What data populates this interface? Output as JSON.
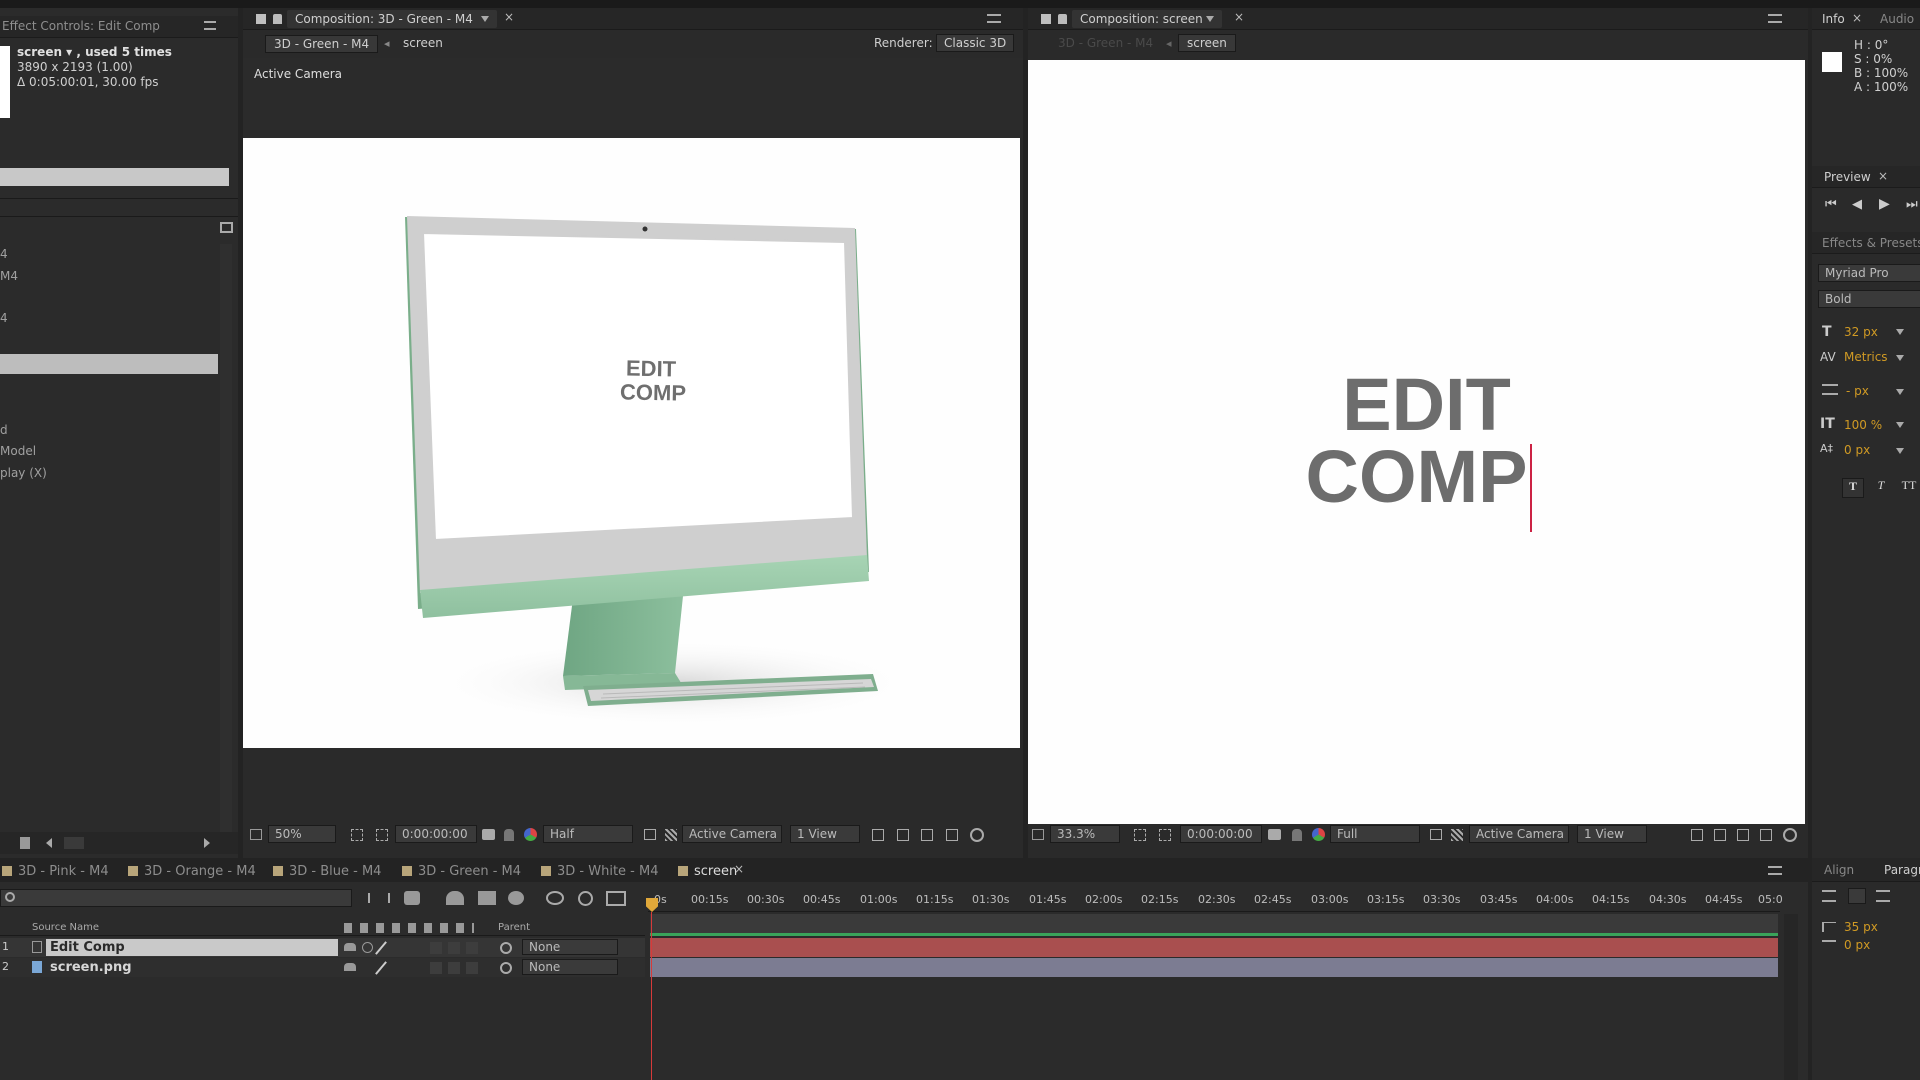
{
  "effect_controls": {
    "title": "Effect Controls: Edit Comp",
    "layer_name": "screen ▾ , used 5 times",
    "dims": "3890 x 2193 (1.00)",
    "duration": "Δ 0:05:00:01, 30.00 fps",
    "items": [
      "4",
      "M4",
      "4",
      "d",
      " Model",
      "play (X)"
    ]
  },
  "comp_left": {
    "tab": "Composition: 3D - Green - M4",
    "crumb1": "3D - Green - M4",
    "crumb2": "screen",
    "renderer_label": "Renderer:",
    "renderer_value": "Classic 3D",
    "camera_label": "Active Camera",
    "screen_text_1": "EDIT",
    "screen_text_2": "COMP",
    "footer": {
      "zoom": "50%",
      "time": "0:00:00:00",
      "quality": "Half",
      "camera": "Active Camera",
      "views": "1 View"
    }
  },
  "comp_right": {
    "tab": "Composition: screen",
    "crumb1": "3D - Green - M4",
    "crumb2": "screen",
    "text_1": "EDIT",
    "text_2": "COMP",
    "footer": {
      "zoom": "33.3%",
      "time": "0:00:00:00",
      "quality": "Full",
      "camera": "Active Camera",
      "views": "1 View"
    }
  },
  "info": {
    "tab": "Info",
    "tab2": "Audio",
    "values": [
      "H : 0°",
      "S : 0%",
      "B : 100%",
      "A : 100%"
    ]
  },
  "preview": {
    "tab": "Preview"
  },
  "effects_presets": {
    "tab": "Effects & Presets"
  },
  "character": {
    "font": "Myriad Pro",
    "style": "Bold",
    "size": "32 px",
    "kerning": "Metrics",
    "leading": "- px",
    "vscale": "100 %",
    "baseline": "0 px"
  },
  "align_panel": {
    "tab1": "Align",
    "tab2": "Paragr",
    "indent1": "35 px",
    "indent2": "0 px"
  },
  "timeline": {
    "tabs": [
      "3D - Pink - M4",
      "3D - Orange - M4",
      "3D - Blue - M4",
      "3D - Green - M4",
      "3D - White - M4",
      "screen"
    ],
    "ruler": [
      "0s",
      "00:15s",
      "00:30s",
      "00:45s",
      "01:00s",
      "01:15s",
      "01:30s",
      "01:45s",
      "02:00s",
      "02:15s",
      "02:30s",
      "02:45s",
      "03:00s",
      "03:15s",
      "03:30s",
      "03:45s",
      "04:00s",
      "04:15s",
      "04:30s",
      "04:45s",
      "05:0"
    ],
    "col_source": "Source Name",
    "col_parent": "Parent",
    "layers": [
      {
        "num": "1",
        "name": "Edit Comp",
        "parent": "None"
      },
      {
        "num": "2",
        "name": "screen.png",
        "parent": "None"
      }
    ]
  },
  "colors": {
    "accent_orange": "#d09a24",
    "layer1_bar": "#b05252",
    "layer2_bar": "#7f7f94",
    "monitor_green": "#9bcbaa"
  }
}
